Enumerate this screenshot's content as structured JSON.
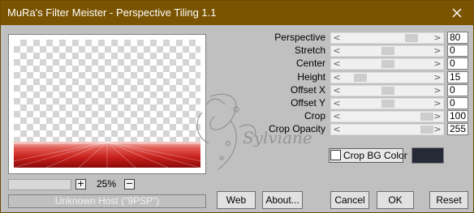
{
  "window": {
    "title": "MuRa's Filter Meister - Perspective Tiling 1.1"
  },
  "preview": {
    "zoom": "25%",
    "zoom_in": "+",
    "zoom_out": "−",
    "status": "Unknown Host (\"9PSP\")"
  },
  "params": [
    {
      "label": "Perspective",
      "value": "80",
      "level": 0.8,
      "has_box": true
    },
    {
      "label": "Stretch",
      "value": "0",
      "level": 0.5,
      "has_box": true
    },
    {
      "label": "Center",
      "value": "0",
      "level": 0.5,
      "has_box": true
    },
    {
      "label": "Height",
      "value": "15",
      "level": 0.15,
      "has_box": true
    },
    {
      "label": "Offset X",
      "value": "0",
      "level": 0.5,
      "has_box": true
    },
    {
      "label": "Offset Y",
      "value": "0",
      "level": 0.5,
      "has_box": true
    },
    {
      "label": "Crop",
      "value": "100",
      "level": 1.0,
      "has_box": true
    },
    {
      "label": "Crop Opacity",
      "value": "255",
      "level": 1.0,
      "has_box": true
    }
  ],
  "crop_bg": {
    "label": "Crop BG Color",
    "checked": false,
    "color": "#262a36"
  },
  "watermark": {
    "text": "Sylviane"
  },
  "buttons": {
    "web": "Web",
    "about": "About...",
    "cancel": "Cancel",
    "ok": "OK",
    "reset": "Reset"
  },
  "colors": {
    "titlebar": "#7a5400",
    "floor_red": "#c8201c"
  }
}
